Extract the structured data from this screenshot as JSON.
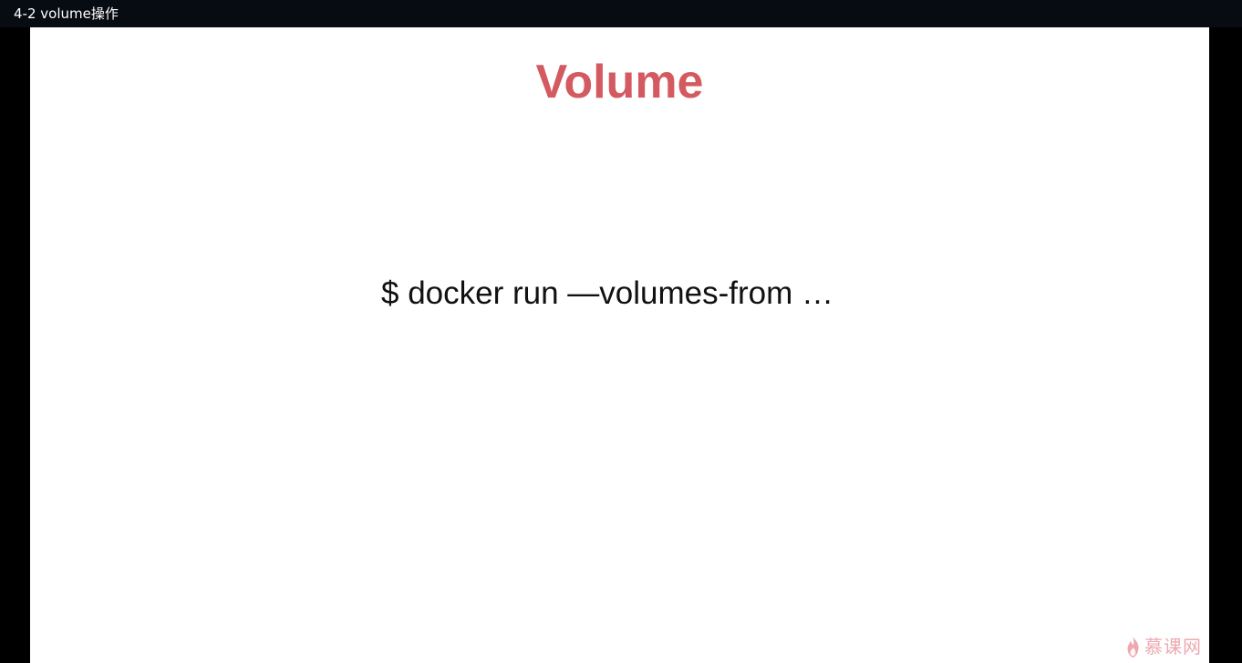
{
  "window": {
    "title": "4-2 volume操作"
  },
  "slide": {
    "title": "Volume",
    "command": "$ docker run —volumes-from …"
  },
  "watermark": {
    "text": "慕课网",
    "icon": "flame-icon",
    "color": "#eba1a8"
  },
  "colors": {
    "title_bar": "#070b12",
    "slide_title": "#d45a61",
    "slide_background": "#ffffff",
    "video_background": "#000000"
  }
}
